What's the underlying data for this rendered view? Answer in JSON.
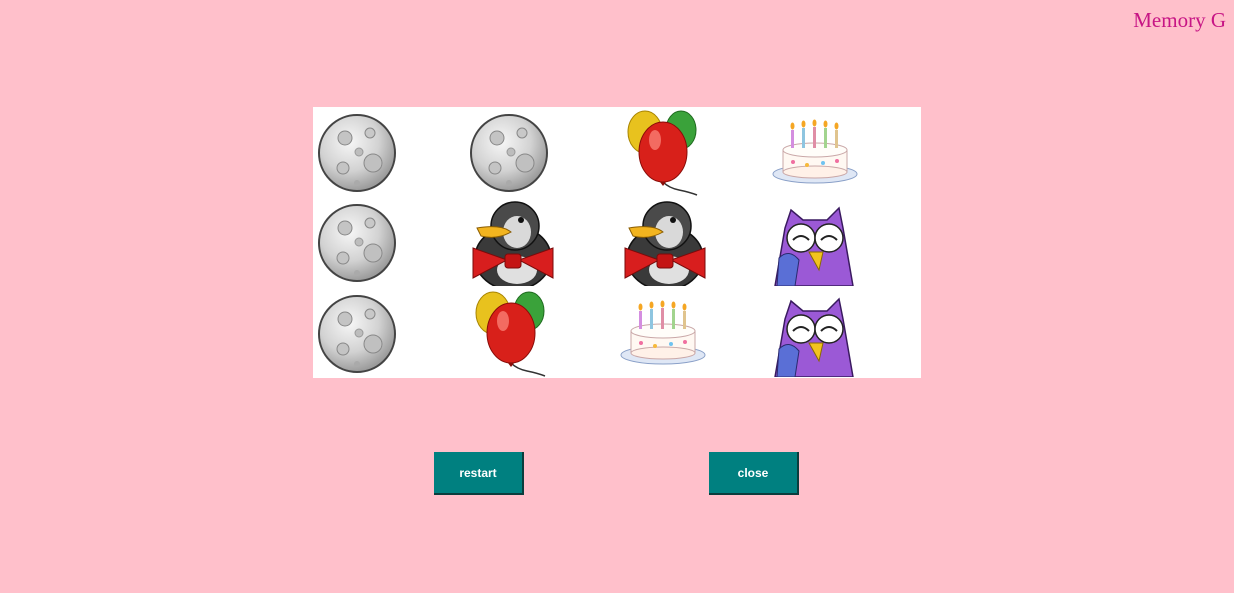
{
  "header": {
    "title": "Memory G"
  },
  "board": {
    "rows": 3,
    "columns": 4,
    "cards": [
      [
        "moon",
        "moon",
        "balloons",
        "birthday-cake"
      ],
      [
        "moon",
        "penguin",
        "penguin",
        "owl"
      ],
      [
        "moon",
        "balloons",
        "birthday-cake",
        "owl"
      ]
    ]
  },
  "controls": {
    "restart_label": "restart",
    "close_label": "close"
  },
  "colors": {
    "background": "#ffc0cb",
    "title": "#c71585",
    "button": "#008080",
    "board": "#ffffff"
  }
}
